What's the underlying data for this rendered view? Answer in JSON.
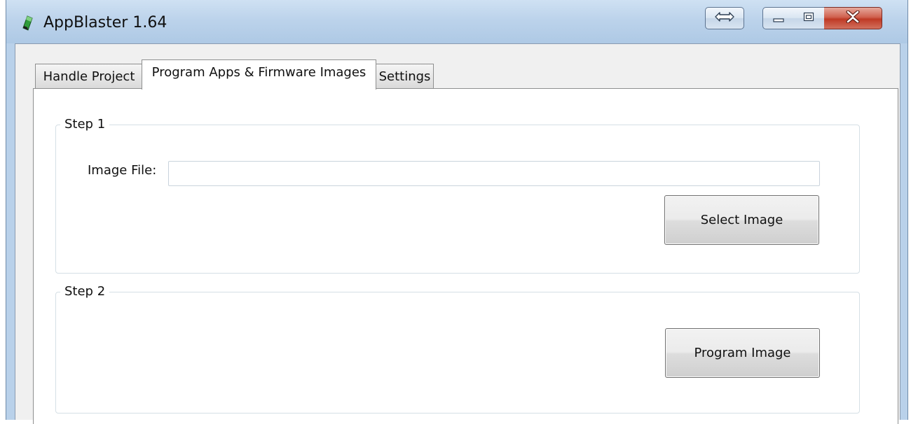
{
  "window": {
    "title": "AppBlaster 1.64",
    "close_label": "x"
  },
  "tabs": [
    {
      "label": "Handle Project",
      "active": false
    },
    {
      "label": "Program Apps & Firmware Images",
      "active": true
    },
    {
      "label": "Settings",
      "active": false
    }
  ],
  "step1": {
    "legend": "Step 1",
    "image_file_label": "Image File:",
    "image_file_value": "",
    "select_button": "Select Image"
  },
  "step2": {
    "legend": "Step 2",
    "program_button": "Program Image"
  },
  "icons": {
    "app": "app-icon",
    "resize": "resize-arrows-icon",
    "minimize": "minimize-icon",
    "maximize": "maximize-icon",
    "close": "close-icon"
  },
  "colors": {
    "titlebar": "#bcd3eb",
    "close_button": "#c9452f",
    "client_bg": "#f0f0f0"
  }
}
